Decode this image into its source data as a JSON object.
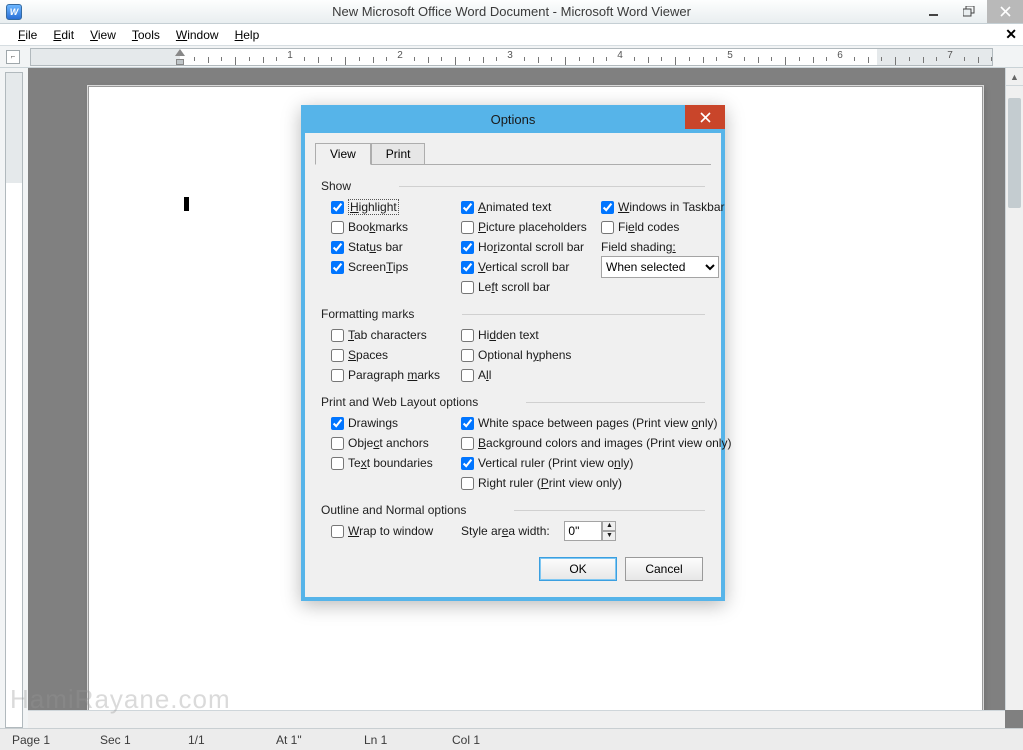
{
  "window": {
    "title": "New Microsoft Office Word Document - Microsoft Word Viewer",
    "app_initial": "W"
  },
  "menu": {
    "file": "File",
    "edit": "Edit",
    "view": "View",
    "tools": "Tools",
    "window": "Window",
    "help": "Help"
  },
  "ruler": {
    "numbers": [
      "1",
      "2",
      "3",
      "4",
      "5",
      "6",
      "7"
    ]
  },
  "status": {
    "page": "Page  1",
    "sec": "Sec 1",
    "pages": "1/1",
    "at": "At  1\"",
    "ln": "Ln  1",
    "col": "Col  1"
  },
  "watermark": "HamiRayane.com",
  "dialog": {
    "title": "Options",
    "tabs": {
      "view": "View",
      "print": "Print"
    },
    "groups": {
      "show": {
        "label": "Show",
        "highlight": "Highlight",
        "bookmarks": "Bookmarks",
        "statusbar": "Status bar",
        "screentips": "ScreenTips",
        "animated": "Animated text",
        "picture": "Picture placeholders",
        "hscroll": "Horizontal scroll bar",
        "vscroll": "Vertical scroll bar",
        "lscroll": "Left scroll bar",
        "wintask": "Windows in Taskbar",
        "fieldcodes": "Field codes",
        "fieldshading_label": "Field shading:",
        "fieldshading_value": "When selected"
      },
      "fmt": {
        "label": "Formatting marks",
        "tab": "Tab characters",
        "spaces": "Spaces",
        "para": "Paragraph marks",
        "hidden": "Hidden text",
        "hyphens": "Optional hyphens",
        "all": "All"
      },
      "pw": {
        "label": "Print and Web Layout options",
        "drawings": "Drawings",
        "anchors": "Object anchors",
        "bounds": "Text boundaries",
        "whitespace": "White space between pages (Print view only)",
        "bgcolors": "Background colors and images (Print view only)",
        "vruler": "Vertical ruler (Print view only)",
        "rruler": "Right ruler (Print view only)"
      },
      "on": {
        "label": "Outline and Normal options",
        "wrap": "Wrap to window",
        "stylewidth_label": "Style area width:",
        "stylewidth_value": "0\""
      }
    },
    "buttons": {
      "ok": "OK",
      "cancel": "Cancel"
    }
  },
  "checked": {
    "highlight": true,
    "bookmarks": false,
    "statusbar": true,
    "screentips": true,
    "animated": true,
    "picture": false,
    "hscroll": true,
    "vscroll": true,
    "lscroll": false,
    "wintask": true,
    "fieldcodes": false,
    "tab": false,
    "spaces": false,
    "para": false,
    "hidden": false,
    "hyphens": false,
    "all": false,
    "drawings": true,
    "anchors": false,
    "bounds": false,
    "whitespace": true,
    "bgcolors": false,
    "vruler": true,
    "rruler": false,
    "wrap": false
  }
}
